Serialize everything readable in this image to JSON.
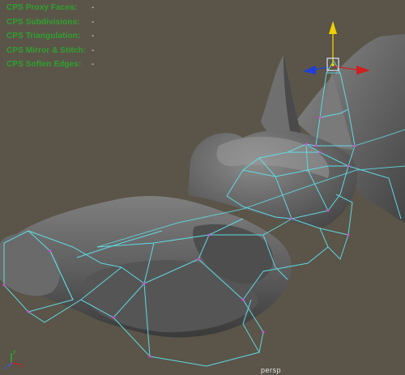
{
  "hud": {
    "rows": [
      {
        "label": "CPS Proxy Faces:",
        "value": "-"
      },
      {
        "label": "CPS Subdivisions:",
        "value": "-"
      },
      {
        "label": "CPS Triangulation:",
        "value": "-"
      },
      {
        "label": "CPS Mirror & Stitch:",
        "value": "-"
      },
      {
        "label": "CPS Soften Edges:",
        "value": "-"
      }
    ]
  },
  "camera": {
    "name": "persp"
  },
  "axis_indicator": {
    "icon": "view-axis-icon",
    "x_label": "x",
    "y_label": "y",
    "z_label": "z"
  },
  "colors": {
    "background": "#5b5549",
    "hud_label": "#2fa12f",
    "cage_wire": "#5fe0e8",
    "vertex": "#d64bd6",
    "manip_x": "#d01f1f",
    "manip_y": "#f0d000",
    "manip_z": "#1f3fd8"
  }
}
